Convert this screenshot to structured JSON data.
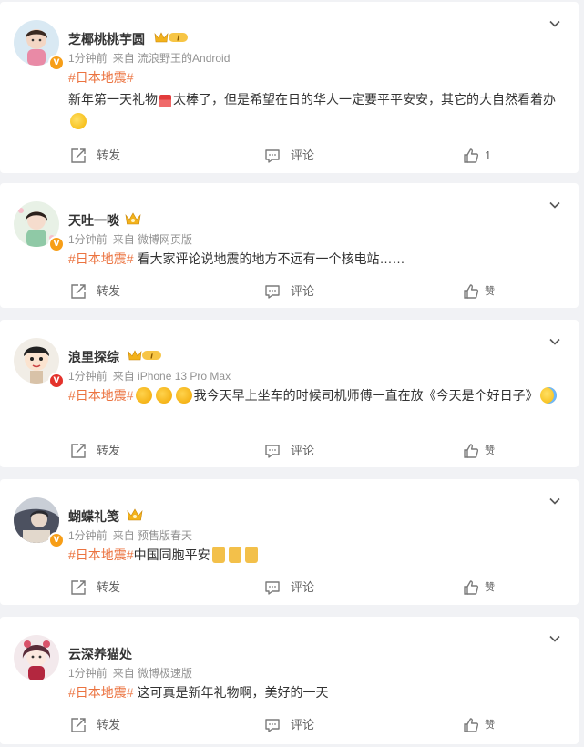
{
  "posts": [
    {
      "username": "芝椰桃桃芋圆",
      "time": "1分钟前",
      "source": "来自 流浪野王的Android",
      "hashtag": "#日本地震#",
      "text": "新年第一天礼物",
      "text_b": "太棒了，但是希望在日的华人一定要平平安安，其它的大自然看着办",
      "actions": {
        "repost": "转发",
        "comment": "评论",
        "likes": "1"
      }
    },
    {
      "username": "天吐一啖",
      "time": "1分钟前",
      "source": "来自 微博网页版",
      "hashtag": "#日本地震#",
      "text": "看大家评论说地震的地方不远有一个核电站……",
      "actions": {
        "repost": "转发",
        "comment": "评论",
        "likes": "赞"
      }
    },
    {
      "username": "浪里探综",
      "time": "1分钟前",
      "source": "来自 iPhone 13 Pro Max",
      "hashtag": "#日本地震#",
      "text": "我今天早上坐车的时候司机师傅一直在放《今天是个好日子》",
      "actions": {
        "repost": "转发",
        "comment": "评论",
        "likes": "赞"
      }
    },
    {
      "username": "蝴蝶礼笺",
      "time": "1分钟前",
      "source": "来自 预售版春天",
      "hashtag": "#日本地震#",
      "text": "中国同胞平安",
      "actions": {
        "repost": "转发",
        "comment": "评论",
        "likes": "赞"
      }
    },
    {
      "username": "云深养猫处",
      "time": "1分钟前",
      "source": "来自 微博极速版",
      "hashtag": "#日本地震#",
      "text": "这可真是新年礼物啊，美好的一天",
      "actions": {
        "repost": "转发",
        "comment": "评论",
        "likes": "赞"
      }
    }
  ],
  "icons": {
    "more": "chevron-down-icon",
    "repost": "share-icon",
    "comment": "comment-icon",
    "like": "thumbs-up-icon",
    "verified": "verified-v-icon",
    "member": "crown-member-icon"
  },
  "colors": {
    "hashtag": "#eb7340",
    "badge_orange": "#f79e17",
    "badge_red": "#e4322b",
    "meta": "#939393"
  }
}
